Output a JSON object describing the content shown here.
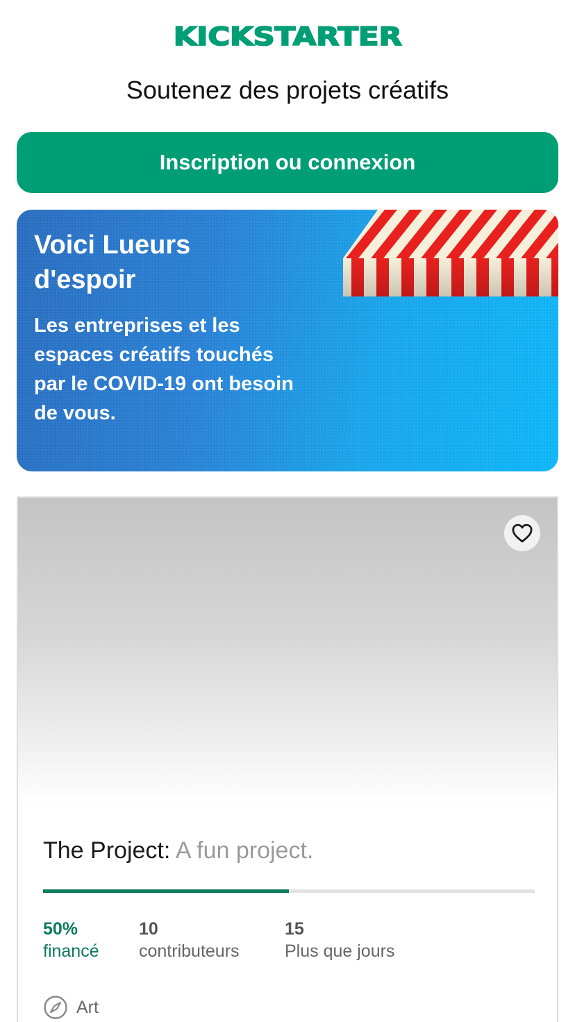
{
  "brand": {
    "logo_text": "KICKSTARTER",
    "color": "#009e74"
  },
  "header": {
    "tagline": "Soutenez des projets créatifs"
  },
  "cta": {
    "label": "Inscription ou connexion"
  },
  "banner": {
    "title": "Voici Lueurs d'espoir",
    "body": "Les entreprises et les espaces créatifs touchés par le COVID-19 ont besoin de vous."
  },
  "project": {
    "name": "The Project:",
    "blurb": "A fun project.",
    "percent_funded": 0.5,
    "stats": {
      "funded_value": "50%",
      "funded_label": "financé",
      "backers_value": "10",
      "backers_label": "contributeurs",
      "days_value": "15",
      "days_label": "Plus que jours"
    },
    "category": "Art",
    "favorite_icon": "heart-outline-icon",
    "category_icon": "compass-icon"
  }
}
